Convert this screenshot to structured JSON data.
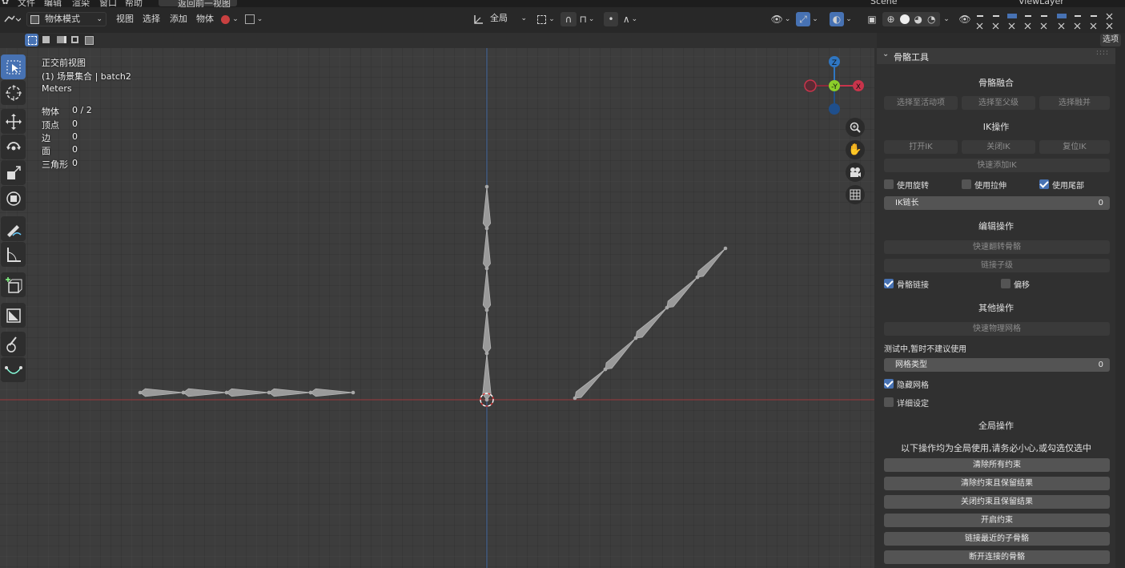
{
  "top_strip": {
    "menus": [
      "文件",
      "编辑",
      "渲染",
      "窗口",
      "帮助"
    ],
    "workspace_tab": "返回前一视图",
    "scene": "Scene",
    "view_layer": "ViewLayer"
  },
  "header": {
    "mode": "物体模式",
    "menus": [
      "视图",
      "选择",
      "添加",
      "物体"
    ],
    "transform_orientation": "全局",
    "options_label": "选项"
  },
  "viewport_info": {
    "view_name": "正交前视图",
    "collection": "(1) 场景集合 | batch2",
    "units": "Meters",
    "stats": [
      {
        "label": "物体",
        "value": "0 / 2"
      },
      {
        "label": "顶点",
        "value": "0"
      },
      {
        "label": "边",
        "value": "0"
      },
      {
        "label": "面",
        "value": "0"
      },
      {
        "label": "三角形",
        "value": "0"
      }
    ]
  },
  "gizmo": {
    "z": "Z",
    "y": "-Y",
    "x": "X"
  },
  "colors": {
    "accent": "#4772b3",
    "x_axis": "#c8344b",
    "z_axis": "#2f76c2",
    "y_axis": "#8bcd2a"
  },
  "panel": {
    "title": "骨骼工具",
    "bone_merge": {
      "title": "骨骼融合",
      "buttons": [
        "选择至活动项",
        "选择至父级",
        "选择融并"
      ]
    },
    "ik": {
      "title": "IK操作",
      "buttons": [
        "打开IK",
        "关闭IK",
        "复位IK"
      ],
      "quick_add": "快速添加IK",
      "checks": [
        {
          "label": "使用旋转",
          "checked": false
        },
        {
          "label": "使用拉伸",
          "checked": false
        },
        {
          "label": "使用尾部",
          "checked": true
        }
      ],
      "chain_label": "IK链长",
      "chain_value": "0"
    },
    "edit": {
      "title": "编辑操作",
      "flip": "快速翻转骨骼",
      "link_children": "链接子级",
      "checks": [
        {
          "label": "骨骼链接",
          "checked": true
        },
        {
          "label": "偏移",
          "checked": false
        }
      ]
    },
    "other": {
      "title": "其他操作",
      "physics_mesh": "快速物理网格",
      "testing_note": "测试中,暂时不建议使用",
      "mesh_type_label": "网格类型",
      "mesh_type_value": "0",
      "checks": [
        {
          "label": "隐藏网格",
          "checked": true
        },
        {
          "label": "详细设定",
          "checked": false
        }
      ]
    },
    "global": {
      "title": "全局操作",
      "warning": "以下操作均为全局使用,请务必小心,或勾选仅选中",
      "buttons": [
        "清除所有约束",
        "清除约束且保留结果",
        "关闭约束且保留结果",
        "开启约束",
        "链接最近的子骨骼",
        "断开连接的骨骼"
      ]
    }
  }
}
